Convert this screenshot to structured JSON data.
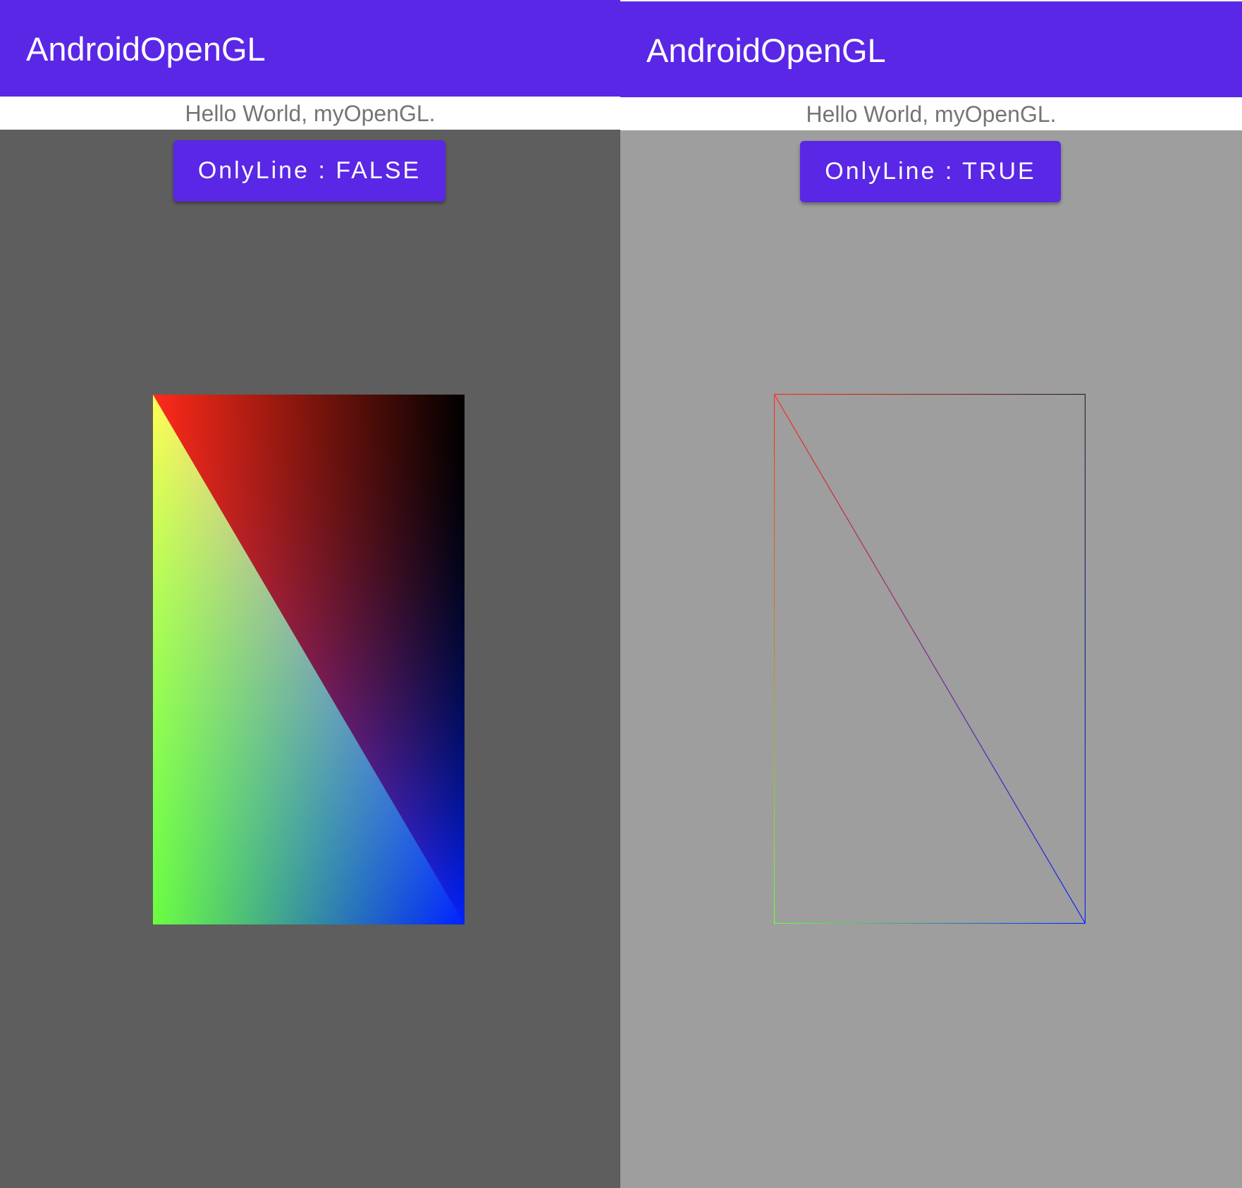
{
  "screens": [
    {
      "app_title": "AndroidOpenGL",
      "hello_text": "Hello World, myOpenGL.",
      "button_label": "OnlyLine : FALSE",
      "render_mode": "filled",
      "background_color": "#5e5e5e"
    },
    {
      "app_title": "AndroidOpenGL",
      "hello_text": "Hello World, myOpenGL.",
      "button_label": "OnlyLine : TRUE",
      "render_mode": "wireframe",
      "background_color": "#9e9e9e"
    }
  ],
  "colors": {
    "accent": "#5a27e6",
    "vertex_top_left": "#ff2a1a",
    "vertex_top_right": "#000000",
    "vertex_bottom_left": "#6cff40",
    "vertex_bottom_right": "#0022ff"
  }
}
